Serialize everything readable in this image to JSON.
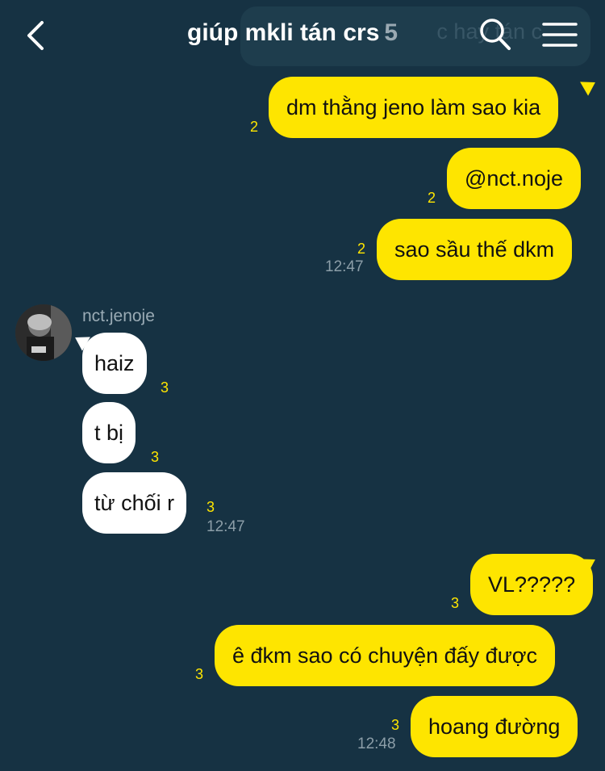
{
  "header": {
    "title": "giúp mkli tán crs",
    "member_count": "5",
    "ghost_search_text": "c hay tán c",
    "icons": {
      "back": "chevron-left-icon",
      "search": "search-icon",
      "menu": "hamburger-menu-icon"
    }
  },
  "colors": {
    "background": "#163243",
    "outgoing_bubble": "#fee500",
    "incoming_bubble": "#ffffff",
    "unread_count": "#fee500",
    "timestamp": "#8c9ea8"
  },
  "messages": {
    "m1": {
      "text": "dm thằng jeno làm sao kia",
      "unread": "2"
    },
    "m2": {
      "text": "@nct.noje",
      "unread": "2"
    },
    "m3": {
      "text": "sao sầu thế dkm",
      "unread": "2",
      "time": "12:47"
    },
    "sender": {
      "name": "nct.jenoje"
    },
    "m4": {
      "text": "haiz",
      "unread": "3"
    },
    "m5": {
      "text": "t bị",
      "unread": "3"
    },
    "m6": {
      "text": "từ chối r",
      "unread": "3",
      "time": "12:47"
    },
    "m7": {
      "text": "VL?????",
      "unread": "3"
    },
    "m8": {
      "text": "ê đkm sao có chuyện đấy được",
      "unread": "3"
    },
    "m9": {
      "text": "hoang đường",
      "unread": "3",
      "time": "12:48"
    }
  }
}
